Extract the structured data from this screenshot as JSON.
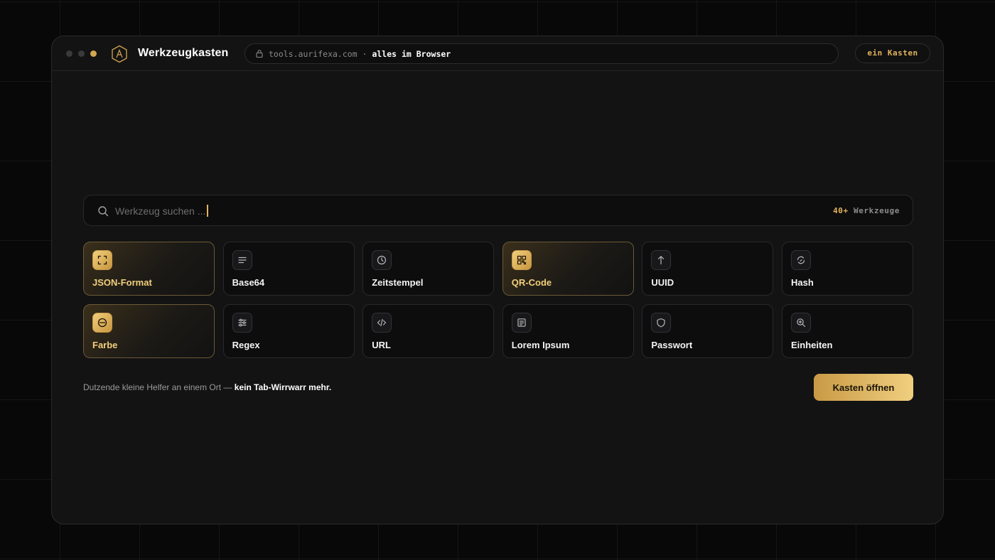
{
  "app": {
    "title": "Werkzeugkasten",
    "url_host": "tools.aurifexa.com",
    "url_separator": "·",
    "url_note": "alles im Browser",
    "pill_label": "ein Kasten"
  },
  "search": {
    "placeholder": "Werkzeug suchen ...",
    "value": "",
    "count_number": "40+",
    "count_label": "Werkzeuge"
  },
  "tools": [
    {
      "label": "JSON-Format",
      "icon": "expand-icon",
      "active": true
    },
    {
      "label": "Base64",
      "icon": "lines-icon",
      "active": false
    },
    {
      "label": "Zeitstempel",
      "icon": "clock-icon",
      "active": false
    },
    {
      "label": "QR-Code",
      "icon": "qr-icon",
      "active": true
    },
    {
      "label": "UUID",
      "icon": "arrow-up-icon",
      "active": false
    },
    {
      "label": "Hash",
      "icon": "loop-icon",
      "active": false
    },
    {
      "label": "Farbe",
      "icon": "circle-minus-icon",
      "active": true
    },
    {
      "label": "Regex",
      "icon": "sliders-icon",
      "active": false
    },
    {
      "label": "URL",
      "icon": "code-icon",
      "active": false
    },
    {
      "label": "Lorem Ipsum",
      "icon": "document-icon",
      "active": false
    },
    {
      "label": "Passwort",
      "icon": "shield-icon",
      "active": false
    },
    {
      "label": "Einheiten",
      "icon": "zoom-icon",
      "active": false
    }
  ],
  "footer": {
    "text_plain": "Dutzende kleine Helfer an einem Ort —",
    "text_bold": "kein Tab-Wirrwarr mehr.",
    "cta_label": "Kasten öffnen"
  },
  "colors": {
    "accent": "#e2b45c",
    "accent_light": "#f2cf7c",
    "window_bg": "#131314",
    "page_bg": "#080808"
  }
}
